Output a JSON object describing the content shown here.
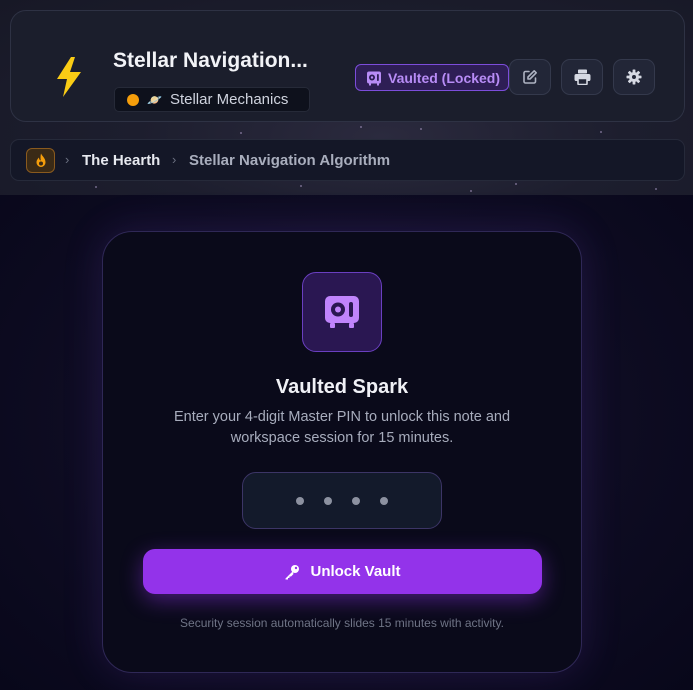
{
  "header": {
    "title": "Stellar Navigation...",
    "workspace": "Stellar Mechanics",
    "status_badge": "Vaulted (Locked)",
    "actions": [
      "edit-icon",
      "print-icon",
      "gear-icon"
    ]
  },
  "breadcrumb": {
    "items": [
      "The Hearth",
      "Stellar Navigation Algorithm"
    ]
  },
  "vault": {
    "title": "Vaulted Spark",
    "description": "Enter your 4-digit Master PIN to unlock this note and workspace session for 15 minutes.",
    "pin_mask": "••••",
    "unlock_label": "Unlock Vault",
    "footnote": "Security session automatically slides 15 minutes with activity."
  },
  "colors": {
    "accent": "#9333ea",
    "badge_text": "#b88cf6",
    "workspace_dot": "#f59e0b",
    "bolt": "#facc15"
  }
}
